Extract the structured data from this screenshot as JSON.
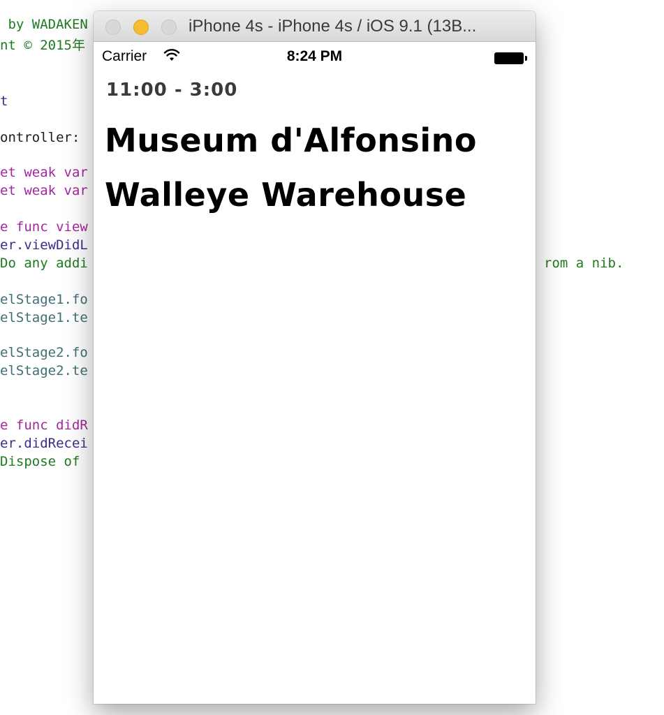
{
  "editor": {
    "lines": [
      {
        "text": " by WADAKEN",
        "color": "green"
      },
      {
        "text": "nt © 2015年",
        "color": "green"
      },
      {
        "text": "t",
        "color": "indigo"
      },
      {
        "text": "ontroller:",
        "color": "black"
      },
      {
        "text": "et weak var",
        "color": "purple"
      },
      {
        "text": "et weak var",
        "color": "purple"
      },
      {
        "text": "e func view",
        "color": "purple"
      },
      {
        "text": "er.viewDidL",
        "color": "indigo"
      },
      {
        "text": "Do any addi",
        "color": "green"
      },
      {
        "text": "elStage1.fo",
        "color": "teal"
      },
      {
        "text": "elStage1.te",
        "color": "teal"
      },
      {
        "text": "elStage2.fo",
        "color": "teal"
      },
      {
        "text": "elStage2.te",
        "color": "teal"
      },
      {
        "text": "e func didR",
        "color": "purple"
      },
      {
        "text": "er.didRecei",
        "color": "indigo"
      },
      {
        "text": "Dispose of ",
        "color": "green"
      }
    ],
    "overflow_text": "rom a nib."
  },
  "window": {
    "title": "iPhone 4s - iPhone 4s / iOS 9.1 (13B..."
  },
  "statusbar": {
    "carrier": "Carrier",
    "time": "8:24 PM"
  },
  "screen": {
    "time_range": "11:00 - 3:00",
    "stage1": "Museum d'Alfonsino",
    "stage2": "Walleye Warehouse"
  },
  "colors": {
    "minimize_button": "#f5bd2f",
    "stage_time_text": "#3a3a3a",
    "stage_label_text": "#000000"
  }
}
